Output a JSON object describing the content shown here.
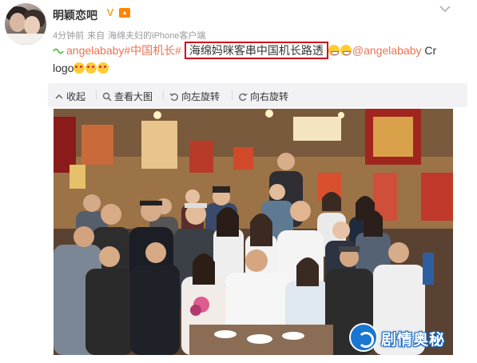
{
  "post": {
    "username": "明颖恋吧",
    "verified_badge": "V",
    "meta": {
      "time": "4分钟前",
      "source_prefix": "来自",
      "source": "海绵夫妇的iPhone客户端"
    },
    "content": {
      "link_text": "angelababy#中国机长#",
      "highlight_text": "海绵妈咪客串中国机长路透",
      "mention": "@angelababy",
      "tail": " Cr",
      "line2_text": "logo"
    }
  },
  "toolbar": {
    "collapse_label": "收起",
    "view_large_label": "查看大图",
    "rotate_left_label": "向左旋转",
    "rotate_right_label": "向右旋转"
  },
  "photo": {
    "watermark_text": "剧情奥秘"
  },
  "colors": {
    "link": "#eb7350",
    "highlight_border": "#d0021b",
    "toolbar_bg": "#f2f2f5",
    "watermark_blue": "#1976d2"
  }
}
